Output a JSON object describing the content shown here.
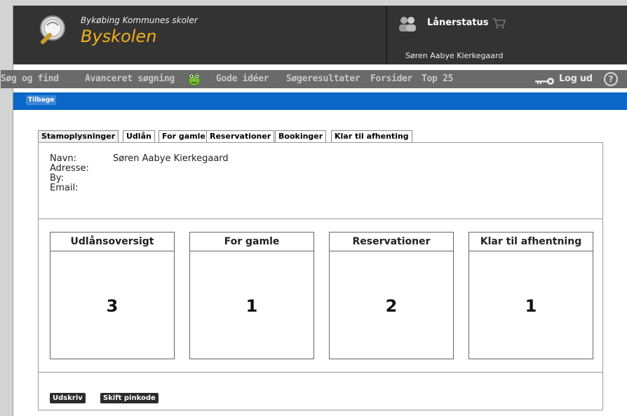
{
  "header": {
    "school_line": "Bykøbing Kommunes skoler",
    "school_name": "Byskolen",
    "status_label": "Lånerstatus",
    "user_name": "Søren Aabye Kierkegaard"
  },
  "nav": {
    "items": [
      "Søg og find",
      "Avanceret søgning",
      "Gode idéer",
      "Søgeresultater",
      "Forsider",
      "Top 25"
    ],
    "logout_label": "Log ud",
    "help_label": "?"
  },
  "toolbar": {
    "back_label": "Tilbage"
  },
  "tabs": [
    "Stamoplysninger",
    "Udlån",
    "For gamle",
    "Reservationer",
    "Bookinger",
    "Klar til afhenting"
  ],
  "info": {
    "name_label": "Navn:",
    "name_value": "Søren Aabye Kierkegaard",
    "address_label": "Adresse:",
    "city_label": "By:",
    "email_label": "Email:"
  },
  "cards": [
    {
      "title": "Udlånsoversigt",
      "value": "3"
    },
    {
      "title": "For gamle",
      "value": "1"
    },
    {
      "title": "Reservationer",
      "value": "2"
    },
    {
      "title": "Klar til afhentning",
      "value": "1"
    }
  ],
  "buttons": {
    "print": "Udskriv",
    "pin": "Skift pinkode"
  },
  "colors": {
    "header": "#333333",
    "accent": "#f2b01c",
    "nav": "#6a6a6a",
    "bluebar": "#0a67c8"
  }
}
